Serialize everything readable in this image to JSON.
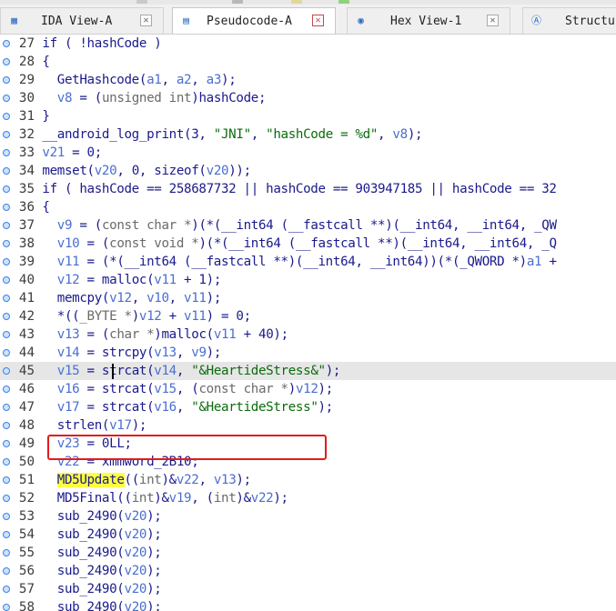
{
  "tabs": [
    {
      "label": "IDA View-A",
      "icon": "graph-icon",
      "close": "✕",
      "active": false
    },
    {
      "label": "Pseudocode-A",
      "icon": "pseudocode-icon",
      "close": "✕",
      "active": true
    },
    {
      "label": "Hex View-1",
      "icon": "hex-view-icon",
      "close": "✕",
      "active": false
    },
    {
      "label": "Structur",
      "icon": "structures-icon",
      "close": "",
      "active": false
    }
  ],
  "colors": {
    "keyword": "#1a1a8c",
    "variable": "#4a6fd0",
    "string": "#0b6b0b",
    "type": "#6a6a6a",
    "highlight_line": "#e6e6e6",
    "match_highlight": "#ffff40",
    "annotation_box": "#e21b1b"
  },
  "code_lines": [
    {
      "num": "27",
      "tokens": [
        [
          "p",
          "  if ( !hashCode )"
        ]
      ]
    },
    {
      "num": "28",
      "tokens": [
        [
          "p",
          "  {"
        ]
      ]
    },
    {
      "num": "29",
      "tokens": [
        [
          "p",
          "    GetHashcode("
        ],
        [
          "v",
          "a1"
        ],
        [
          "p",
          ", "
        ],
        [
          "v",
          "a2"
        ],
        [
          "p",
          ", "
        ],
        [
          "v",
          "a3"
        ],
        [
          "p",
          ");"
        ]
      ]
    },
    {
      "num": "30",
      "tokens": [
        [
          "p",
          "    "
        ],
        [
          "v",
          "v8"
        ],
        [
          "p",
          " = ("
        ],
        [
          "y",
          "unsigned int"
        ],
        [
          "p",
          ")hashCode;"
        ]
      ]
    },
    {
      "num": "31",
      "tokens": [
        [
          "p",
          "  }"
        ]
      ]
    },
    {
      "num": "32",
      "tokens": [
        [
          "p",
          "  __android_log_print(3, "
        ],
        [
          "s",
          "\"JNI\""
        ],
        [
          "p",
          ", "
        ],
        [
          "s",
          "\"hashCode = %d\""
        ],
        [
          "p",
          ", "
        ],
        [
          "v",
          "v8"
        ],
        [
          "p",
          ");"
        ]
      ]
    },
    {
      "num": "33",
      "tokens": [
        [
          "p",
          "  "
        ],
        [
          "v",
          "v21"
        ],
        [
          "p",
          " = 0;"
        ]
      ]
    },
    {
      "num": "34",
      "tokens": [
        [
          "p",
          "  memset("
        ],
        [
          "v",
          "v20"
        ],
        [
          "p",
          ", 0, sizeof("
        ],
        [
          "v",
          "v20"
        ],
        [
          "p",
          "));"
        ]
      ]
    },
    {
      "num": "35",
      "tokens": [
        [
          "p",
          "  if ( hashCode == 258687732 || hashCode == 903947185 || hashCode == 32"
        ]
      ]
    },
    {
      "num": "36",
      "tokens": [
        [
          "p",
          "  {"
        ]
      ]
    },
    {
      "num": "37",
      "tokens": [
        [
          "p",
          "    "
        ],
        [
          "v",
          "v9"
        ],
        [
          "p",
          " = ("
        ],
        [
          "y",
          "const char *"
        ],
        [
          "p",
          ")(*(__int64 (__fastcall **)(__int64, __int64, _QW"
        ]
      ]
    },
    {
      "num": "38",
      "tokens": [
        [
          "p",
          "    "
        ],
        [
          "v",
          "v10"
        ],
        [
          "p",
          " = ("
        ],
        [
          "y",
          "const void *"
        ],
        [
          "p",
          ")(*(__int64 (__fastcall **)(__int64, __int64, _Q"
        ]
      ]
    },
    {
      "num": "39",
      "tokens": [
        [
          "p",
          "    "
        ],
        [
          "v",
          "v11"
        ],
        [
          "p",
          " = (*(__int64 (__fastcall **)(__int64, __int64))(*(_QWORD *)"
        ],
        [
          "v",
          "a1"
        ],
        [
          "p",
          " + "
        ]
      ]
    },
    {
      "num": "40",
      "tokens": [
        [
          "p",
          "    "
        ],
        [
          "v",
          "v12"
        ],
        [
          "p",
          " = malloc("
        ],
        [
          "v",
          "v11"
        ],
        [
          "p",
          " + 1);"
        ]
      ]
    },
    {
      "num": "41",
      "tokens": [
        [
          "p",
          "    memcpy("
        ],
        [
          "v",
          "v12"
        ],
        [
          "p",
          ", "
        ],
        [
          "v",
          "v10"
        ],
        [
          "p",
          ", "
        ],
        [
          "v",
          "v11"
        ],
        [
          "p",
          ");"
        ]
      ]
    },
    {
      "num": "42",
      "tokens": [
        [
          "p",
          "    *(("
        ],
        [
          "y",
          "_BYTE *"
        ],
        [
          "p",
          ")"
        ],
        [
          "v",
          "v12"
        ],
        [
          "p",
          " + "
        ],
        [
          "v",
          "v11"
        ],
        [
          "p",
          ") = 0;"
        ]
      ]
    },
    {
      "num": "43",
      "tokens": [
        [
          "p",
          "    "
        ],
        [
          "v",
          "v13"
        ],
        [
          "p",
          " = ("
        ],
        [
          "y",
          "char *"
        ],
        [
          "p",
          ")malloc("
        ],
        [
          "v",
          "v11"
        ],
        [
          "p",
          " + 40);"
        ]
      ]
    },
    {
      "num": "44",
      "tokens": [
        [
          "p",
          "    "
        ],
        [
          "v",
          "v14"
        ],
        [
          "p",
          " = strcpy("
        ],
        [
          "v",
          "v13"
        ],
        [
          "p",
          ", "
        ],
        [
          "v",
          "v9"
        ],
        [
          "p",
          ");"
        ]
      ]
    },
    {
      "num": "45",
      "tokens": [
        [
          "p",
          "    "
        ],
        [
          "v",
          "v15"
        ],
        [
          "p",
          " = strcat("
        ],
        [
          "v",
          "v14"
        ],
        [
          "p",
          ", "
        ],
        [
          "s",
          "\"&HeartideStress&\""
        ],
        [
          "p",
          ");"
        ]
      ],
      "highlight": true
    },
    {
      "num": "46",
      "tokens": [
        [
          "p",
          "    "
        ],
        [
          "v",
          "v16"
        ],
        [
          "p",
          " = strcat("
        ],
        [
          "v",
          "v15"
        ],
        [
          "p",
          ", ("
        ],
        [
          "y",
          "const char *"
        ],
        [
          "p",
          ")"
        ],
        [
          "v",
          "v12"
        ],
        [
          "p",
          ");"
        ]
      ]
    },
    {
      "num": "47",
      "tokens": [
        [
          "p",
          "    "
        ],
        [
          "v",
          "v17"
        ],
        [
          "p",
          " = strcat("
        ],
        [
          "v",
          "v16"
        ],
        [
          "p",
          ", "
        ],
        [
          "s",
          "\"&HeartideStress\""
        ],
        [
          "p",
          ");"
        ]
      ]
    },
    {
      "num": "48",
      "tokens": [
        [
          "p",
          "    strlen("
        ],
        [
          "v",
          "v17"
        ],
        [
          "p",
          ");"
        ]
      ]
    },
    {
      "num": "49",
      "tokens": [
        [
          "p",
          "    "
        ],
        [
          "v",
          "v23"
        ],
        [
          "p",
          " = 0LL;"
        ]
      ]
    },
    {
      "num": "50",
      "tokens": [
        [
          "p",
          "    "
        ],
        [
          "v",
          "v22"
        ],
        [
          "p",
          " = xmmword_2B10;"
        ]
      ]
    },
    {
      "num": "51",
      "tokens": [
        [
          "p",
          "    "
        ],
        [
          "m",
          "MD5Update"
        ],
        [
          "p",
          "(("
        ],
        [
          "y",
          "int"
        ],
        [
          "p",
          ")&"
        ],
        [
          "v",
          "v22"
        ],
        [
          "p",
          ", "
        ],
        [
          "v",
          "v13"
        ],
        [
          "p",
          ");"
        ]
      ]
    },
    {
      "num": "52",
      "tokens": [
        [
          "p",
          "    MD5Final(("
        ],
        [
          "y",
          "int"
        ],
        [
          "p",
          ")&"
        ],
        [
          "v",
          "v19"
        ],
        [
          "p",
          ", ("
        ],
        [
          "y",
          "int"
        ],
        [
          "p",
          ")&"
        ],
        [
          "v",
          "v22"
        ],
        [
          "p",
          ");"
        ]
      ]
    },
    {
      "num": "53",
      "tokens": [
        [
          "p",
          "    sub_2490("
        ],
        [
          "v",
          "v20"
        ],
        [
          "p",
          ");"
        ]
      ]
    },
    {
      "num": "54",
      "tokens": [
        [
          "p",
          "    sub_2490("
        ],
        [
          "v",
          "v20"
        ],
        [
          "p",
          ");"
        ]
      ]
    },
    {
      "num": "55",
      "tokens": [
        [
          "p",
          "    sub_2490("
        ],
        [
          "v",
          "v20"
        ],
        [
          "p",
          ");"
        ]
      ]
    },
    {
      "num": "56",
      "tokens": [
        [
          "p",
          "    sub_2490("
        ],
        [
          "v",
          "v20"
        ],
        [
          "p",
          ");"
        ]
      ]
    },
    {
      "num": "57",
      "tokens": [
        [
          "p",
          "    sub_2490("
        ],
        [
          "v",
          "v20"
        ],
        [
          "p",
          ");"
        ]
      ]
    },
    {
      "num": "58",
      "tokens": [
        [
          "p",
          "    sub_2490("
        ],
        [
          "v",
          "v20"
        ],
        [
          "p",
          ");"
        ]
      ]
    }
  ]
}
